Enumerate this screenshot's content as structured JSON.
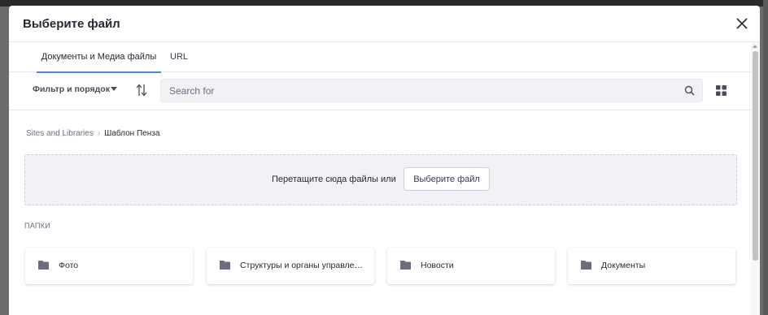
{
  "modal": {
    "title": "Выберите файл"
  },
  "tabs": [
    {
      "label": "Документы и Медиа файлы",
      "active": true
    },
    {
      "label": "URL",
      "active": false
    }
  ],
  "toolbar": {
    "filter_label": "Фильтр и порядок",
    "search_placeholder": "Search for",
    "search_value": ""
  },
  "breadcrumb": {
    "root": "Sites and Libraries",
    "separator": "›",
    "current": "Шаблон Пенза"
  },
  "dropzone": {
    "text": "Перетащите сюда файлы или",
    "button_label": "Выберите файл"
  },
  "folders": {
    "section_label": "ПАПКИ",
    "items": [
      {
        "name": "Фото"
      },
      {
        "name": "Структуры и органы управления"
      },
      {
        "name": "Новости"
      },
      {
        "name": "Документы"
      }
    ]
  },
  "colors": {
    "accent": "#4c85e8",
    "text": "#272833",
    "muted": "#6b6c7e",
    "folder_icon": "#6b6c7e"
  }
}
